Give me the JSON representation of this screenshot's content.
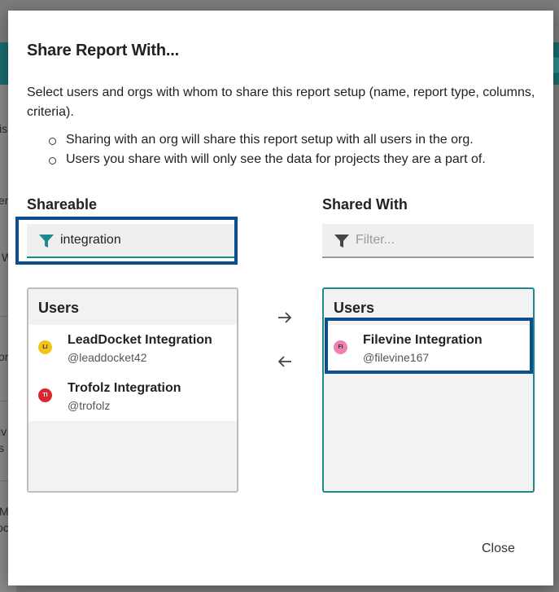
{
  "background": {
    "fragments": [
      "is",
      "er",
      "W",
      "or",
      "iv",
      "s",
      "M",
      "oc"
    ]
  },
  "dialog": {
    "title": "Share Report With...",
    "description": "Select users and orgs with whom to share this report setup (name, report type, columns, criteria).",
    "bullets": [
      "Sharing with an org will share this report setup with all users in the org.",
      "Users you share with will only see the data for projects they are a part of."
    ],
    "close_label": "Close"
  },
  "shareable": {
    "label": "Shareable",
    "filter_value": "integration",
    "list_header": "Users",
    "users": [
      {
        "initials": "LI",
        "name": "LeadDocket Integration",
        "handle": "@leaddocket42",
        "color": "#f2c418",
        "text_color": "#333333"
      },
      {
        "initials": "TI",
        "name": "Trofolz Integration",
        "handle": "@trofolz",
        "color": "#d9262e",
        "text_color": "#ffffff"
      }
    ]
  },
  "shared_with": {
    "label": "Shared With",
    "filter_placeholder": "Filter...",
    "list_header": "Users",
    "users": [
      {
        "initials": "FI",
        "name": "Filevine Integration",
        "handle": "@filevine167",
        "color": "#f07fb3",
        "text_color": "#333333"
      }
    ]
  },
  "colors": {
    "accent": "#1c8a8d",
    "highlight": "#0a4f8f"
  }
}
